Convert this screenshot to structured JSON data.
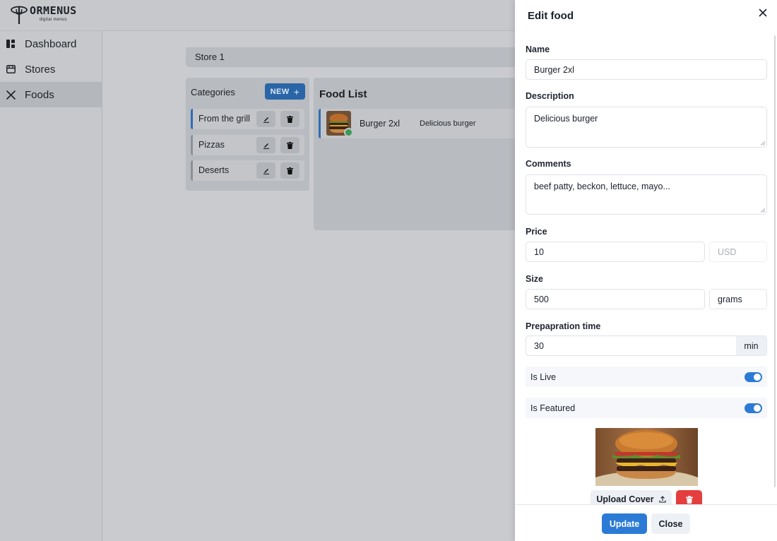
{
  "app": {
    "brand_name": "ORMENUS",
    "brand_tagline": "digital menus"
  },
  "sidebar": {
    "items": [
      {
        "label": "Dashboard",
        "icon": "dashboard-icon"
      },
      {
        "label": "Stores",
        "icon": "store-icon"
      },
      {
        "label": "Foods",
        "icon": "utensils-icon",
        "active": true
      }
    ]
  },
  "store": {
    "name": "Store 1"
  },
  "categories": {
    "heading": "Categories",
    "new_label": "NEW",
    "new_icon": "plus-icon",
    "items": [
      {
        "label": "From the grill",
        "selected": true
      },
      {
        "label": "Pizzas"
      },
      {
        "label": "Deserts"
      }
    ]
  },
  "food_list": {
    "title": "Food List",
    "items": [
      {
        "name": "Burger 2xl",
        "description": "Delicious burger",
        "live": true
      }
    ]
  },
  "drawer": {
    "title": "Edit food",
    "close_icon": "close-icon",
    "fields": {
      "name": {
        "label": "Name",
        "value": "Burger 2xl"
      },
      "description": {
        "label": "Description",
        "value": "Delicious burger"
      },
      "comments": {
        "label": "Comments",
        "value": "beef patty, beckon, lettuce, mayo..."
      },
      "price": {
        "label": "Price",
        "value": "10",
        "currency": "USD"
      },
      "size": {
        "label": "Size",
        "value": "500",
        "unit": "grams"
      },
      "prep_time": {
        "label": "Prepapration time",
        "value": "30",
        "unit": "min"
      }
    },
    "toggles": {
      "is_live": {
        "label": "Is Live",
        "on": true
      },
      "is_featured": {
        "label": "Is Featured",
        "on": true
      }
    },
    "upload_label": "Upload Cover",
    "upload_icon": "upload-icon",
    "delete_icon": "trash-icon",
    "update_label": "Update",
    "close_label": "Close"
  },
  "colors": {
    "accent": "#2b7bd6",
    "danger": "#e53e3e",
    "live": "#3a9a55"
  }
}
